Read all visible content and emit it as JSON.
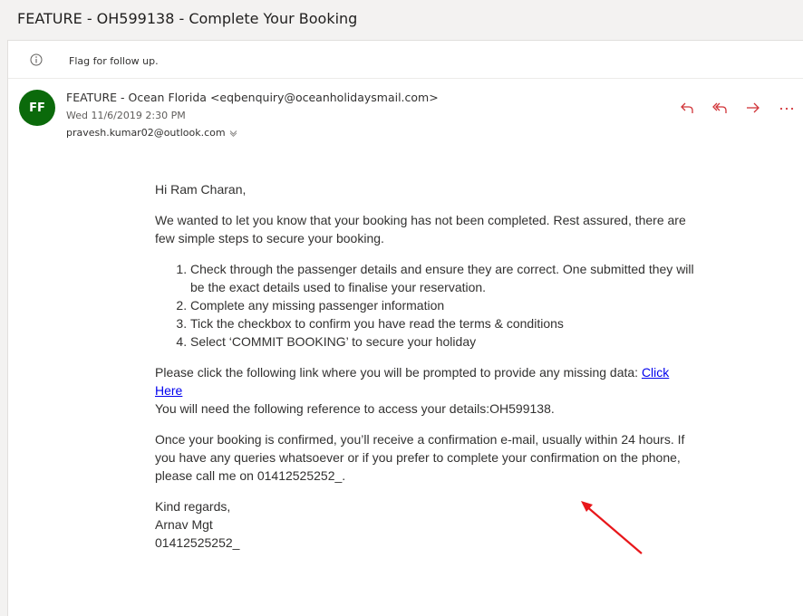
{
  "subject": "FEATURE - OH599138 - Complete Your Booking",
  "flag": {
    "text": "Flag for follow up.",
    "icon": "info-icon"
  },
  "sender": {
    "initials": "FF",
    "avatar_color": "#0b6a0b",
    "from": "FEATURE - Ocean Florida <eqbenquiry@oceanholidaysmail.com>",
    "date": "Wed 11/6/2019 2:30 PM",
    "to": "pravesh.kumar02@outlook.com"
  },
  "actions": [
    {
      "name": "reply-icon",
      "color": "#d13438"
    },
    {
      "name": "reply-all-icon",
      "color": "#d13438"
    },
    {
      "name": "forward-icon",
      "color": "#d13438"
    },
    {
      "name": "more-icon",
      "color": "#d13438"
    }
  ],
  "body": {
    "greeting": "Hi Ram Charan,",
    "intro": "We wanted to let you know that your booking has not been completed. Rest assured, there are few simple steps to secure your booking.",
    "steps": [
      "Check through the passenger details and ensure they are correct. One submitted they will be the exact details used to finalise your reservation.",
      "Complete any missing passenger information",
      "Tick the checkbox to confirm you have read the terms & conditions",
      "Select ‘COMMIT BOOKING’ to secure your holiday"
    ],
    "link_prompt": "Please click the following link where you will be prompted to provide any missing data: ",
    "link_text": "Click Here",
    "reference": "You will need the following reference to access your details:OH599138.",
    "confirmation": "Once your booking is confirmed, you’ll receive a confirmation e-mail, usually within 24 hours. If you have any queries whatsoever or if you prefer to complete your confirmation on the phone, please call me on 01412525252_.",
    "signoff": "Kind regards,",
    "name": "Arnav Mgt",
    "phone": "01412525252_"
  },
  "annotation": {
    "name": "red-arrow-annotation",
    "color": "#e8171b"
  }
}
